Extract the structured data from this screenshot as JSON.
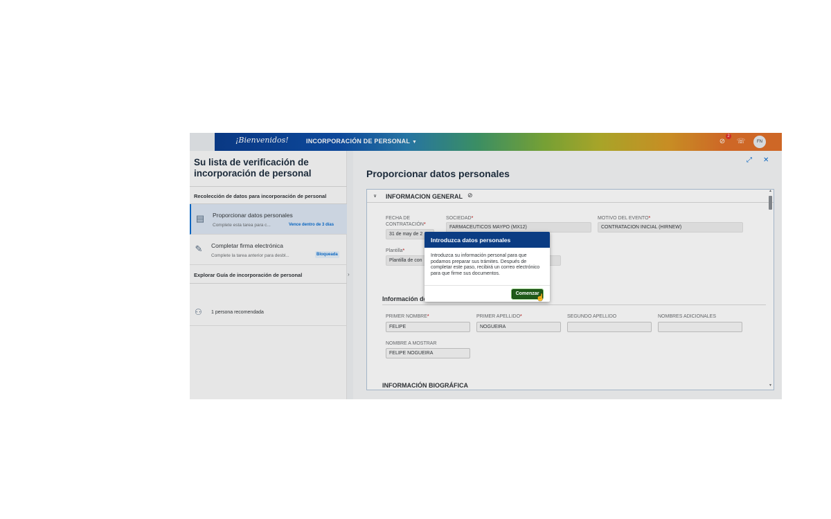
{
  "shell": {
    "logo_text": "¡Bienvenidos!",
    "app_title": "INCORPORACIÓN DE PERSONAL",
    "notification_count": "2",
    "avatar_initials": "FN"
  },
  "left": {
    "heading": "Su lista de verificación de incorporación de personal",
    "section1": "Recolección de datos para incorporación de personal",
    "tasks": [
      {
        "title": "Proporcionar datos personales",
        "desc": "Complete esta tarea para c...",
        "tag": "Vence dentro de 3 días"
      },
      {
        "title": "Completar firma electrónica",
        "desc": "Complete la tarea anterior para desbl...",
        "tag": "Bloqueada"
      }
    ],
    "section2": "Explorar Guía de incorporación de personal",
    "recommended": "1 persona recomendada"
  },
  "right": {
    "heading": "Proporcionar datos personales",
    "section_title": "INFORMACION GENERAL",
    "fields": {
      "hire_date_label": "FECHA DE CONTRATACIÓN",
      "hire_date_value": "31 de may de 2",
      "company_label": "SOCIEDAD",
      "company_value": "FARMACEUTICOS MAYPO (MX12)",
      "event_label": "MOTIVO DEL EVENTO",
      "event_value": "CONTRATACION INICIAL (HIRNEW)",
      "template_label": "Plantilla",
      "template_value": "Plantilla de con"
    },
    "name_section": "Información de nombre",
    "name_fields": {
      "first_name_label": "PRIMER NOMBRE",
      "first_name_value": "FELIPE",
      "last_name_label": "PRIMER APELLIDO",
      "last_name_value": "NOGUEIRA",
      "second_last_label": "SEGUNDO APELLIDO",
      "second_last_value": "",
      "additional_label": "NOMBRES ADICIONALES",
      "additional_value": "",
      "display_label": "NOMBRE A MOSTRAR",
      "display_value": "FELIPE NOGUEIRA"
    },
    "bio_section": "INFORMACIÓN BIOGRÁFICA"
  },
  "dialog": {
    "title": "Introduzca datos personales",
    "body": "Introduzca su información personal para que podamos preparar sus trámites. Después de completar este paso, recibirá un correo electrónico para que firme sus documentos.",
    "button": "Comenzar"
  },
  "icons": {
    "notifications": "bell-icon",
    "feedback": "feedback-icon",
    "expand": "expand-icon",
    "close": "close-icon",
    "task1": "contact-card-icon",
    "task2": "signature-icon",
    "person": "person-icon"
  },
  "colors": {
    "dialog_header": "#0b3c83",
    "primary_button": "#1f5b1a",
    "accent": "#0a6ed1"
  }
}
